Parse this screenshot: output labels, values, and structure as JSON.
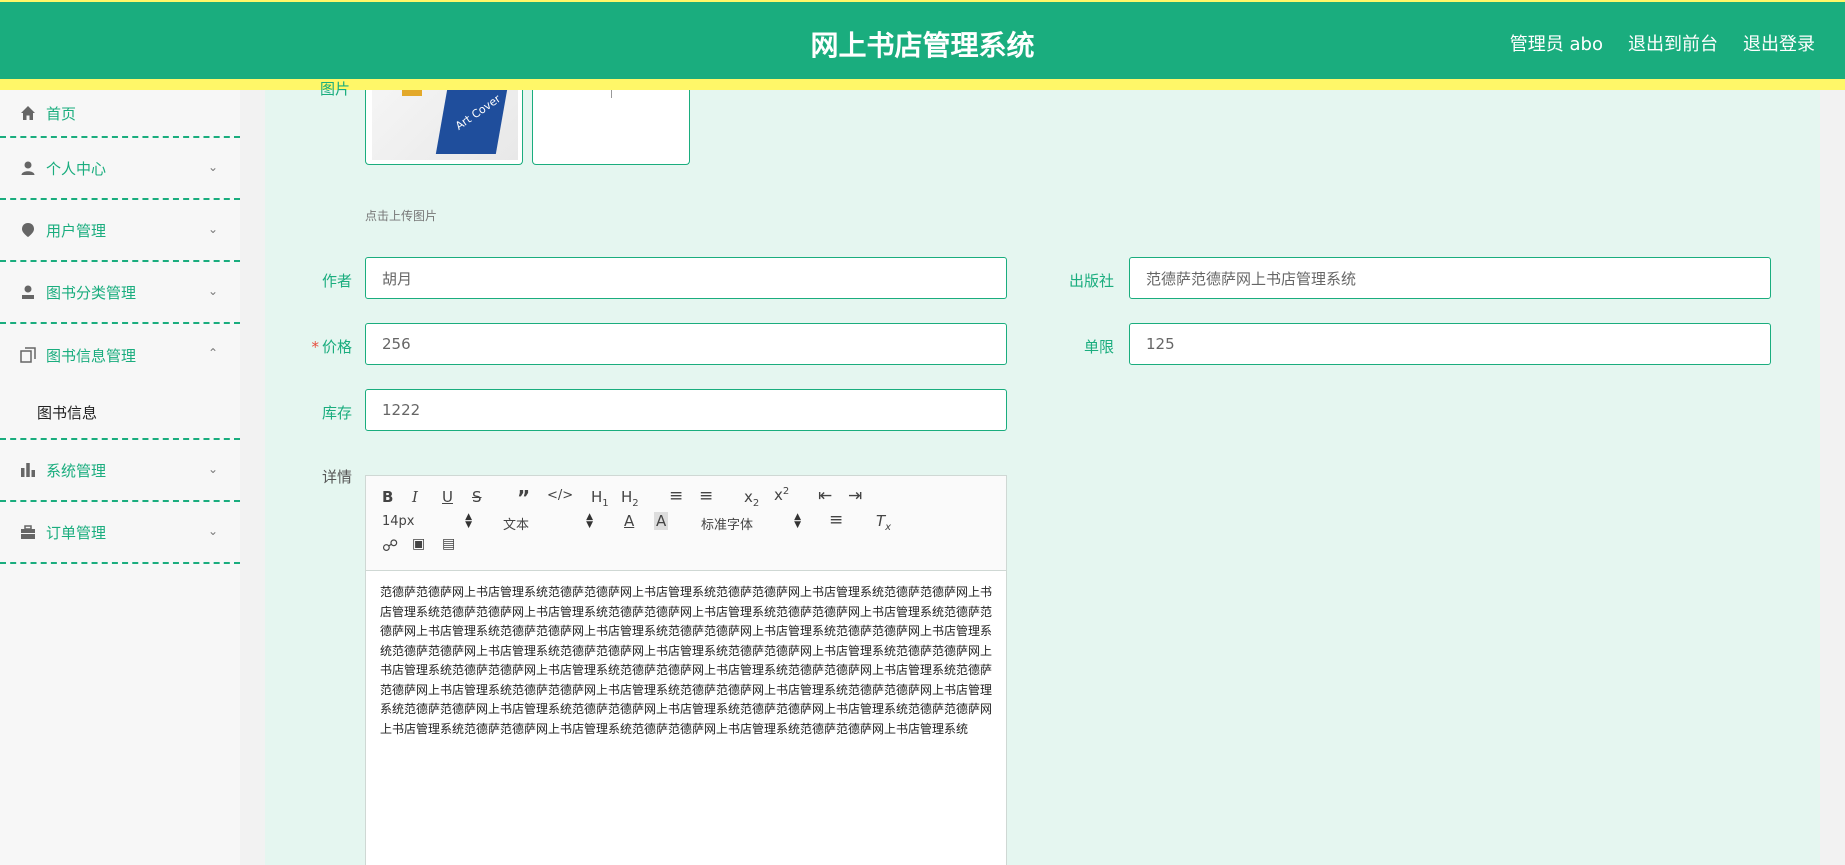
{
  "header": {
    "title": "网上书店管理系统",
    "admin": "管理员 abo",
    "front_link": "退出到前台",
    "logout_link": "退出登录"
  },
  "sidebar": {
    "items": [
      {
        "label": "首页",
        "icon": "home-icon"
      },
      {
        "label": "个人中心",
        "icon": "user-icon"
      },
      {
        "label": "用户管理",
        "icon": "pin-icon"
      },
      {
        "label": "图书分类管理",
        "icon": "person-icon"
      },
      {
        "label": "图书信息管理",
        "icon": "copy-icon",
        "open": true,
        "children": [
          "图书信息"
        ]
      },
      {
        "label": "系统管理",
        "icon": "bar-chart-icon"
      },
      {
        "label": "订单管理",
        "icon": "briefcase-icon"
      }
    ]
  },
  "form": {
    "image_label": "图片",
    "upload_hint": "点击上传图片",
    "cover_text": "Art Cover",
    "author_label": "作者",
    "author_value": "胡月",
    "publisher_label": "出版社",
    "publisher_value": "范德萨范德萨网上书店管理系统",
    "price_label": "价格",
    "price_value": "256",
    "limit_label": "单限",
    "limit_value": "125",
    "stock_label": "库存",
    "stock_value": "1222",
    "detail_label": "详情"
  },
  "editor": {
    "font_size": "14px",
    "text_style": "文本",
    "font_family": "标准字体",
    "content": "范德萨范德萨网上书店管理系统范德萨范德萨网上书店管理系统范德萨范德萨网上书店管理系统范德萨范德萨网上书店管理系统范德萨范德萨网上书店管理系统范德萨范德萨网上书店管理系统范德萨范德萨网上书店管理系统范德萨范德萨网上书店管理系统范德萨范德萨网上书店管理系统范德萨范德萨网上书店管理系统范德萨范德萨网上书店管理系统范德萨范德萨网上书店管理系统范德萨范德萨网上书店管理系统范德萨范德萨网上书店管理系统范德萨范德萨网上书店管理系统范德萨范德萨网上书店管理系统范德萨范德萨网上书店管理系统范德萨范德萨网上书店管理系统范德萨范德萨网上书店管理系统范德萨范德萨网上书店管理系统范德萨范德萨网上书店管理系统范德萨范德萨网上书店管理系统范德萨范德萨网上书店管理系统范德萨范德萨网上书店管理系统范德萨范德萨网上书店管理系统范德萨范德萨网上书店管理系统范德萨范德萨网上书店管理系统范德萨范德萨网上书店管理系统范德萨范德萨网上书店管理系统"
  },
  "colors": {
    "primary": "#1aad7e",
    "accent": "#fff768"
  }
}
